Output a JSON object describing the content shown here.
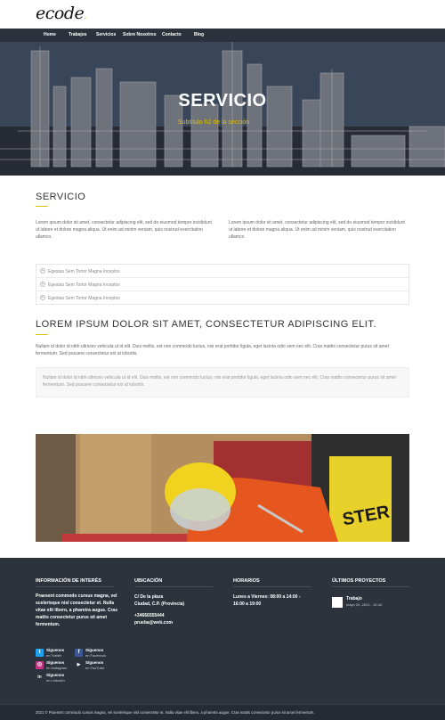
{
  "header": {
    "logo_text": "ecode",
    "logo_dot": "."
  },
  "nav": {
    "items": [
      "Home",
      "Trabajos",
      "Servicios",
      "Sobre Nosotros",
      "Contacto",
      "Blog"
    ]
  },
  "hero": {
    "title": "SERVICIO",
    "subtitle": "Subtítulo h2 de la sección"
  },
  "service": {
    "title": "SERVICIO",
    "col1": "Lorem ipsum dolor sit amet, consectetur adipiscing elit, sed do eiusmod tempor incididunt ut labore et dolore magna aliqua. Ut enim ad minim veniam, quis nostrud exercitation ullamco.",
    "col2": "Lorem ipsum dolor sit amet, consectetur adipiscing elit, sed do eiusmod tempor incididunt ut labore et dolore magna aliqua. Ut enim ad minim veniam, quis nostrud exercitation ullamco."
  },
  "accordion": {
    "items": [
      "Egestas Sem Tortor Magna Inceptos",
      "Egestas Sem Tortor Magna Inceptos",
      "Egestas Sem Tortor Magna Inceptos"
    ],
    "icon": "+"
  },
  "lorem": {
    "title": "LOREM IPSUM DOLOR SIT AMET, CONSECTETUR ADIPISCING ELIT.",
    "body": "Nullam id dolor id nibh ultricies vehicula ut id elit. Duis mollis, est non commodo luctus, nisi erat porttitor ligula, eget lacinia odio sem nec elit. Cras mattis consectetur purus sit amet fermentum. Sed posuere consectetur est at lobortis.",
    "quote": "Nullam id dolor id nibh ultricies vehicula ut id elit. Duis mollis, est non commodo luctus, nisi erat porttitor ligula, eget lacinia odio sem nec elit. Cras mattis consectetur purus sit amet fermentum. Sed posuere consectetur est at lobortis."
  },
  "footer": {
    "info": {
      "heading": "INFORMACIÓN DE INTERÉS",
      "text": "Praesent commodo cursus magna, vel scelerisque nisl consectetur et. Nulla vitae elit libero, a pharetra augue. Cras mattis consectetur purus sit amet fermentum."
    },
    "social": [
      {
        "line1": "Síguenos",
        "line2": "en Twitter",
        "icon": "twitter-icon",
        "glyph": "t",
        "color": "#1da1f2"
      },
      {
        "line1": "Síguenos",
        "line2": "en Facebook",
        "icon": "facebook-icon",
        "glyph": "f",
        "color": "#3b5998"
      },
      {
        "line1": "Síguenos",
        "line2": "en Instagram",
        "icon": "instagram-icon",
        "glyph": "◎",
        "color": "#c13584"
      },
      {
        "line1": "Síguenos",
        "line2": "en YouTube",
        "icon": "youtube-icon",
        "glyph": "▶",
        "color": "#2d333c"
      },
      {
        "line1": "Síguenos",
        "line2": "en LinkedIn",
        "icon": "linkedin-icon",
        "glyph": "in",
        "color": "#2d333c"
      }
    ],
    "location": {
      "heading": "UBICACIÓN",
      "address1": "C/ De la plaza",
      "address2": "Ciudad, C.P. (Provincia)",
      "phone": "+34666555444",
      "email": "prueba@web.com"
    },
    "hours": {
      "heading": "HORARIOS",
      "line1": "Lunes a Viernes: 08:00 a 14:00 -",
      "line2": "16:00 a 19:00"
    },
    "projects": {
      "heading": "ÚLTIMOS PROYECTOS",
      "item_title": "Trabajo",
      "item_date": "mayo 20, 2021 - 10:44"
    },
    "copyright": "2021 © Praesent commodo cursus magna, vel scelerisque nisl consectetur et. Nulla vitae elit libero, a pharetra augue. Cras mattis consectetur purus sit amet fermentum."
  },
  "colors": {
    "accent": "#e3c000",
    "nav_bg": "#2b323b",
    "footer_bg": "#2d333c"
  }
}
